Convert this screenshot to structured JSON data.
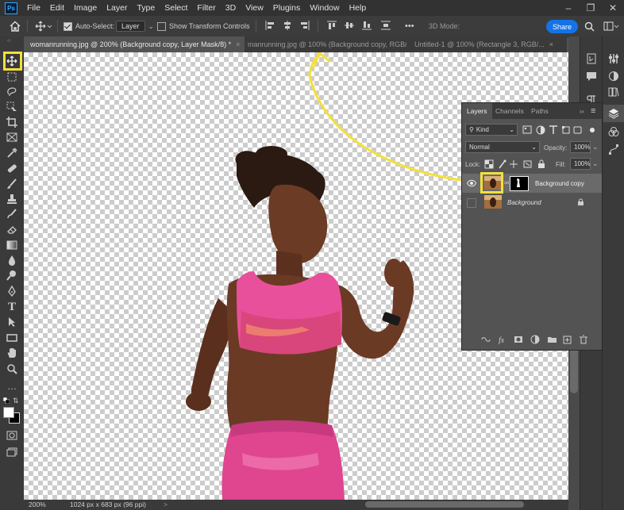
{
  "app": {
    "logo_text": "Ps"
  },
  "menu": [
    "File",
    "Edit",
    "Image",
    "Layer",
    "Type",
    "Select",
    "Filter",
    "3D",
    "View",
    "Plugins",
    "Window",
    "Help"
  ],
  "options_bar": {
    "auto_select_label": "Auto-Select:",
    "auto_select_checked": true,
    "auto_select_target": "Layer",
    "transform_label": "Show Transform Controls",
    "transform_checked": false,
    "more_label": "•••",
    "mode_3d_label": "3D Mode:",
    "share_label": "Share"
  },
  "tabs": [
    {
      "label": "womanrunning.jpg @ 200% (Background copy, Layer Mask/8) *",
      "close": "×",
      "active": true
    },
    {
      "label": "manrunning.jpg @ 100% (Background copy, RGB/...",
      "close": "×",
      "active": false
    },
    {
      "label": "Untitled-1 @ 100% (Rectangle 3, RGB/...",
      "close": "×",
      "active": false
    }
  ],
  "status": {
    "zoom": "200%",
    "doc_info": "1024 px x 683 px (96 ppi)",
    "arrow": ">"
  },
  "layers_panel": {
    "tabs": [
      "Layers",
      "Channels",
      "Paths"
    ],
    "filter_label": "Kind",
    "blend_mode": "Normal",
    "opacity_label": "Opacity:",
    "opacity_value": "100%",
    "lock_label": "Lock:",
    "fill_label": "Fill:",
    "fill_value": "100%",
    "layers": [
      {
        "name": "Background copy",
        "visible": true,
        "has_mask": true
      },
      {
        "name": "Background",
        "visible": false,
        "locked": true
      }
    ],
    "footer_icons": [
      "link-icon",
      "fx-icon",
      "mask-icon",
      "adjustment-icon",
      "group-icon",
      "new-layer-icon",
      "trash-icon"
    ]
  },
  "colors": {
    "highlight": "#f4e03a",
    "accent": "#1473e6",
    "pink": "#ea4f9a"
  }
}
